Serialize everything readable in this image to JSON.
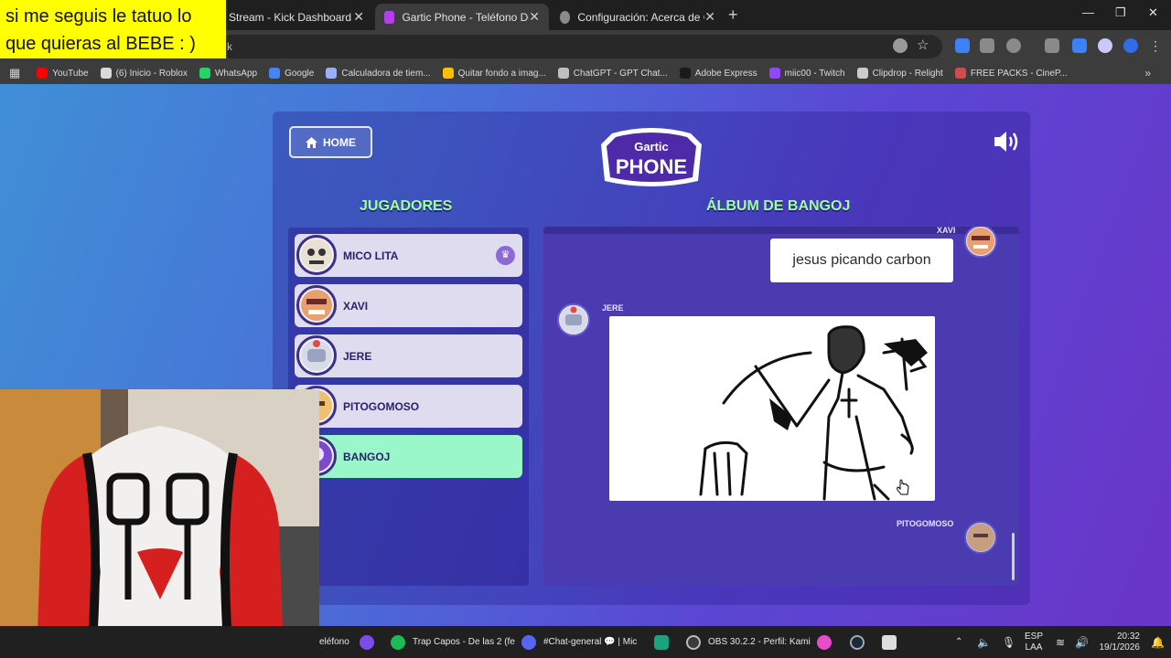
{
  "caption": {
    "line1": "si me seguis le tatuo lo",
    "line2": "que quieras al BEBE : )"
  },
  "tabs": [
    {
      "title": "Stream - Kick Dashboard",
      "active": false
    },
    {
      "title": "Gartic Phone - Teléfono Descon",
      "active": true
    },
    {
      "title": "Configuración: Acerca de CClea",
      "active": false
    }
  ],
  "bookmarks": [
    {
      "label": "YouTube",
      "color": "#ff0000"
    },
    {
      "label": "(6) Inicio - Roblox",
      "color": "#d9d9d9"
    },
    {
      "label": "WhatsApp",
      "color": "#25d366"
    },
    {
      "label": "Google",
      "color": "#4285f4"
    },
    {
      "label": "Calculadora de tiem...",
      "color": "#9ab0ff"
    },
    {
      "label": "Quitar fondo a imag...",
      "color": "#ffbf00"
    },
    {
      "label": "ChatGPT - GPT Chat...",
      "color": "#bfbfbf"
    },
    {
      "label": "Adobe Express",
      "color": "#1a1a1a"
    },
    {
      "label": "miic00 - Twitch",
      "color": "#9146ff"
    },
    {
      "label": "Clipdrop - Relight",
      "color": "#cccccc"
    },
    {
      "label": "FREE PACKS - CineP...",
      "color": "#d04b4b"
    }
  ],
  "page": {
    "home_label": "HOME",
    "logo_top": "Gartic",
    "logo_bottom": "PHONE",
    "players_heading": "JUGADORES",
    "album_heading": "ÁLBUM DE BANGOJ",
    "players": [
      {
        "name": "MICO LITA",
        "host": true
      },
      {
        "name": "XAVI"
      },
      {
        "name": "JERE"
      },
      {
        "name": "PITOGOMOSO"
      },
      {
        "name": "BANGOJ",
        "current": true
      }
    ],
    "album": {
      "entry1_author": "XAVI",
      "entry1_text": "jesus picando carbon",
      "entry2_author": "JERE",
      "entry3_author": "PITOGOMOSO"
    }
  },
  "taskbar": {
    "items": [
      {
        "label": "eléfono"
      },
      {
        "label": "Trap Capos - De las 2 (fe"
      },
      {
        "label": "#Chat-general 💬 | Mic"
      },
      {
        "label": "OBS 30.2.2 - Perfil: Kami"
      }
    ],
    "lang_top": "ESP",
    "lang_bottom": "LAA",
    "time": "20:32",
    "date": "19/1/2026"
  },
  "colors": {
    "accent_green": "#9dff9f",
    "current_player": "#9af7c9",
    "caption_bg": "#ffff00"
  }
}
